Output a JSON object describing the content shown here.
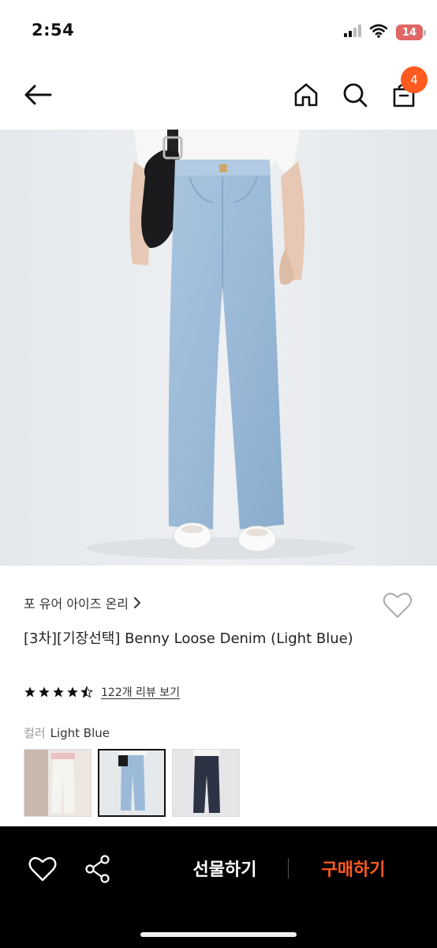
{
  "status_bar": {
    "time": "2:54",
    "battery": "14",
    "icons": [
      "signal-icon",
      "wifi-icon",
      "battery-icon"
    ]
  },
  "nav": {
    "icons": [
      "back-arrow-icon",
      "home-icon",
      "search-icon",
      "shopping-bag-icon"
    ],
    "cart_count": "4"
  },
  "product": {
    "brand": "포 유어 아이즈 온리",
    "title": "[3차][기장선택] Benny Loose Denim (Light Blue)",
    "rating": 4.5,
    "review_link": "122개 리뷰 보기",
    "color_label": "컬러",
    "color_value": "Light Blue",
    "swatches": [
      {
        "name": "white-denim",
        "selected": false
      },
      {
        "name": "light-blue-denim",
        "selected": true
      },
      {
        "name": "dark-navy-denim",
        "selected": false
      }
    ]
  },
  "bottom_bar": {
    "gift_label": "선물하기",
    "buy_label": "구매하기",
    "icons": [
      "heart-icon",
      "share-icon"
    ]
  },
  "colors": {
    "accent": "#ff5a1f",
    "bottom_bar_bg": "#000000",
    "text": "#222222"
  }
}
